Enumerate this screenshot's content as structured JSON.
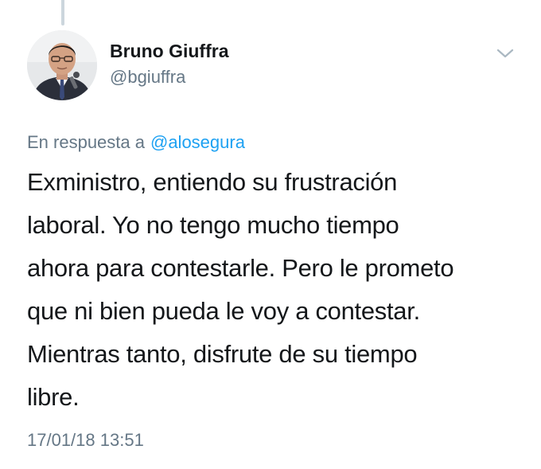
{
  "tweet": {
    "author": {
      "display_name": "Bruno Giuffra",
      "handle": "@bgiuffra",
      "avatar_icon": "profile-photo"
    },
    "menu_icon": "chevron-down-icon",
    "reply_context": {
      "prefix": "En respuesta a",
      "mention": "@alosegura"
    },
    "text_lines": [
      "Exministro, entiendo su frustración",
      "laboral. Yo no tengo mucho tiempo",
      "ahora para contestarle. Pero le prometo",
      "que ni bien pueda le voy a contestar.",
      "Mientras tanto, disfrute de su tiempo",
      "libre."
    ],
    "timestamp": "17/01/18 13:51"
  },
  "colors": {
    "text_primary": "#14171a",
    "text_secondary": "#657786",
    "link": "#1da1f2",
    "thread_line": "#ccd6dd"
  }
}
